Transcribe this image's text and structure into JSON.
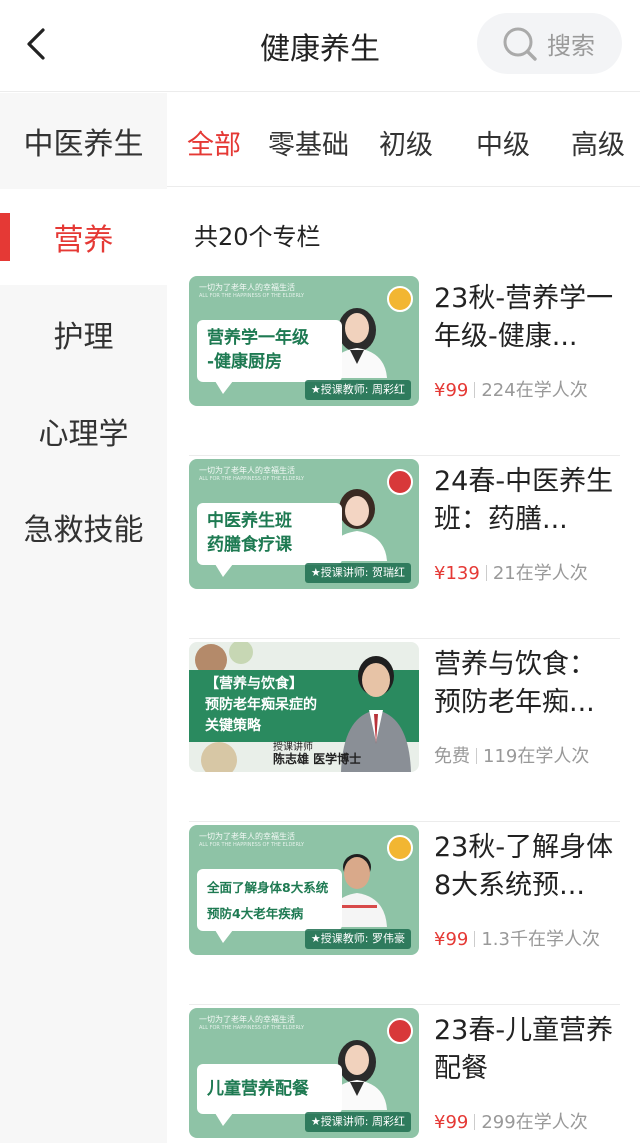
{
  "header": {
    "title": "健康养生",
    "search_label": "搜索"
  },
  "sidebar": {
    "items": [
      {
        "label": "中医养生"
      },
      {
        "label": "营养"
      },
      {
        "label": "护理"
      },
      {
        "label": "心理学"
      },
      {
        "label": "急救技能"
      }
    ],
    "active_index": 1
  },
  "tabs": [
    "全部",
    "零基础",
    "初级",
    "中级",
    "高级"
  ],
  "active_tab_index": 0,
  "count_text": "共20个专栏",
  "banner_text": {
    "slogan": "一切为了老年人的幸福生活",
    "slogan_en": "ALL FOR THE HAPPINESS OF THE ELDERLY"
  },
  "courses": [
    {
      "title": "23秋-营养学一年级-健康...",
      "price": "¥99",
      "learners": "224在学人次",
      "thumb_lines": [
        "营养学一年级",
        "-健康厨房"
      ],
      "teacher": "★授课教师: 周彩红"
    },
    {
      "title": "24春-中医养生班：药膳...",
      "price": "¥139",
      "learners": "21在学人次",
      "thumb_lines": [
        "中医养生班",
        "药膳食疗课"
      ],
      "teacher": "★授课讲师: 贺瑞红"
    },
    {
      "title": "营养与饮食：预防老年痴...",
      "price": "免费",
      "learners": "119在学人次",
      "thumb_lines": [
        "【营养与饮食】",
        "预防老年痴呆症的",
        "关键策略"
      ],
      "lecturer_tag": "授课讲师",
      "lecturer_name": "陈志雄 医学博士"
    },
    {
      "title": "23秋-了解身体8大系统预...",
      "price": "¥99",
      "learners": "1.3千在学人次",
      "thumb_lines": [
        "全面了解身体8大系统",
        "预防4大老年疾病"
      ],
      "teacher": "★授课教师: 罗伟豪"
    },
    {
      "title": "23春-儿童营养配餐",
      "price": "¥99",
      "learners": "299在学人次",
      "thumb_lines": [
        "儿童营养配餐"
      ],
      "teacher": "★授课讲师: 周彩红"
    }
  ]
}
